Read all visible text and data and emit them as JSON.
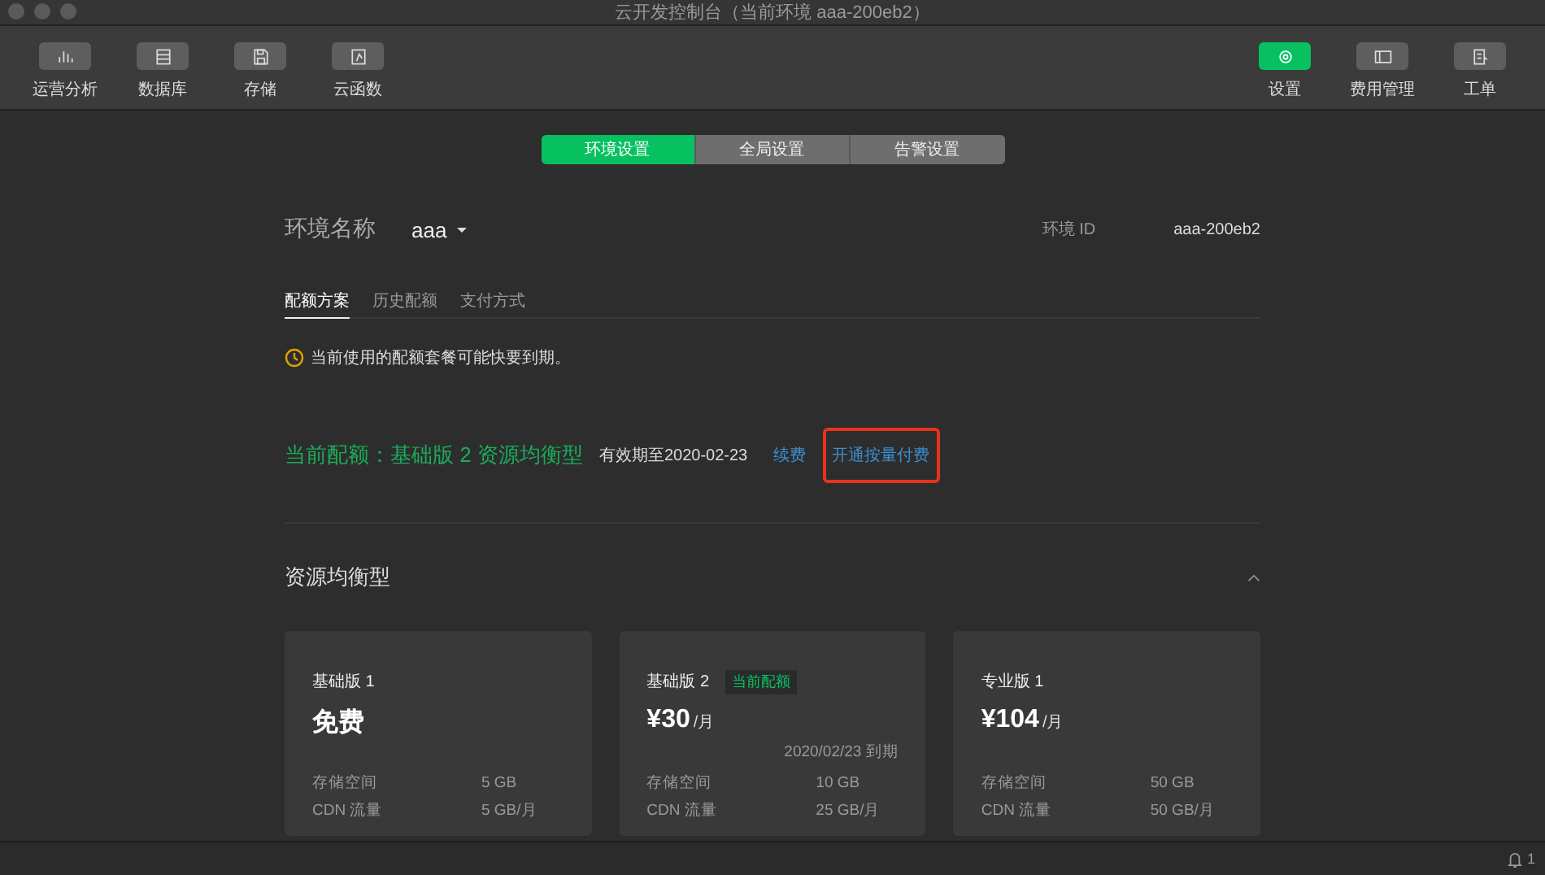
{
  "window": {
    "title": "云开发控制台（当前环境 aaa-200eb2）"
  },
  "toolbar_left": [
    {
      "label": "运营分析",
      "selected": false
    },
    {
      "label": "数据库",
      "selected": false
    },
    {
      "label": "存储",
      "selected": false
    },
    {
      "label": "云函数",
      "selected": false
    }
  ],
  "toolbar_right": [
    {
      "label": "设置",
      "selected": true
    },
    {
      "label": "费用管理",
      "selected": false
    },
    {
      "label": "工单",
      "selected": false
    }
  ],
  "tabs": [
    {
      "label": "环境设置",
      "selected": true
    },
    {
      "label": "全局设置",
      "selected": false
    },
    {
      "label": "告警设置",
      "selected": false
    }
  ],
  "environment": {
    "label": "环境名称",
    "name": "aaa",
    "id_label": "环境 ID",
    "id": "aaa-200eb2"
  },
  "sub_tabs": [
    {
      "label": "配额方案",
      "selected": true
    },
    {
      "label": "历史配额",
      "selected": false
    },
    {
      "label": "支付方式",
      "selected": false
    }
  ],
  "warning": "当前使用的配额套餐可能快要到期。",
  "current_quota": {
    "title": "当前配额：基础版 2 资源均衡型",
    "expiry": "有效期至2020-02-23",
    "links": [
      {
        "label": "续费",
        "highlighted": false
      },
      {
        "label": "开通按量付费",
        "highlighted": true
      }
    ]
  },
  "section": {
    "title": "资源均衡型",
    "expanded": true
  },
  "plans": [
    {
      "name": "基础版 1",
      "price": "免费",
      "specs": [
        {
          "label": "存储空间",
          "value": "5 GB"
        },
        {
          "label": "CDN 流量",
          "value": "5 GB/月"
        }
      ]
    },
    {
      "name": "基础版 2",
      "badge": "当前配额",
      "price": "¥30",
      "unit": "/月",
      "expiry": "2020/02/23 到期",
      "specs": [
        {
          "label": "存储空间",
          "value": "10 GB"
        },
        {
          "label": "CDN 流量",
          "value": "25 GB/月"
        }
      ]
    },
    {
      "name": "专业版 1",
      "price": "¥104",
      "unit": "/月",
      "specs": [
        {
          "label": "存储空间",
          "value": "50 GB"
        },
        {
          "label": "CDN 流量",
          "value": "50 GB/月"
        }
      ]
    }
  ],
  "status_bar": {
    "notifications": "1"
  }
}
